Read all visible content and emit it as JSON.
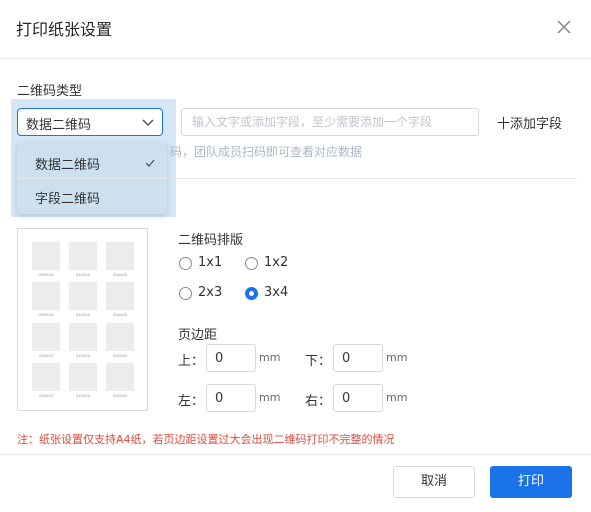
{
  "dialog": {
    "title": "打印纸张设置",
    "close_icon": "close-icon"
  },
  "qr_type": {
    "label": "二维码类型",
    "selected": "数据二维码",
    "options": [
      "数据二维码",
      "字段二维码"
    ]
  },
  "field_input": {
    "placeholder": "输入文字或添加字段，至少需要添加一个字段",
    "value": ""
  },
  "add_field": {
    "label": "十添加字段"
  },
  "hint_text": "码，团队成员扫码即可查看对应数据",
  "preview": {
    "caption": "xxxxxx"
  },
  "layout": {
    "label": "二维码排版",
    "options": [
      "1x1",
      "1x2",
      "2x3",
      "3x4"
    ],
    "selected": "3x4"
  },
  "margins": {
    "label": "页边距",
    "top_label": "上：",
    "bottom_label": "下：",
    "left_label": "左：",
    "right_label": "右：",
    "top": "0",
    "bottom": "0",
    "left": "0",
    "right": "0",
    "unit": "mm"
  },
  "warning": "注：纸张设置仅支持A4纸，若页边距设置过大会出现二维码打印不完整的情况",
  "buttons": {
    "cancel": "取消",
    "print": "打印"
  },
  "colors": {
    "primary": "#1a73e8",
    "warning": "#e04a3a",
    "dropdown_bg": "#cde0f0"
  }
}
